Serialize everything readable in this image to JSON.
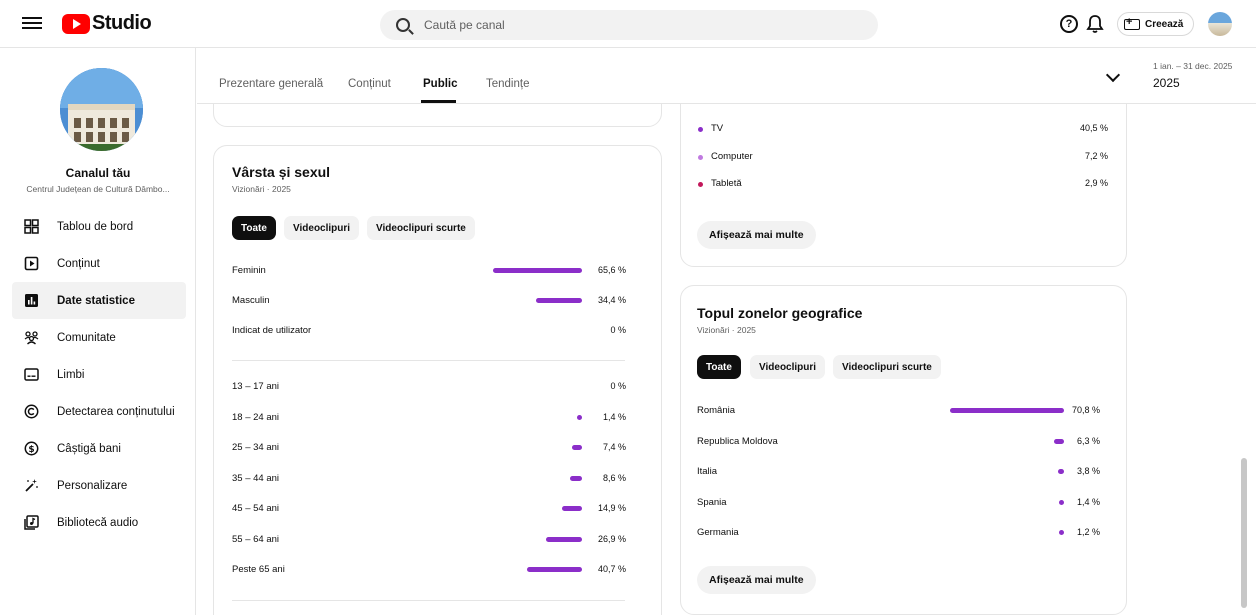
{
  "header": {
    "logo_text": "Studio",
    "search_placeholder": "Caută pe canal",
    "help_label": "?",
    "create_label": "Creează"
  },
  "sidebar": {
    "channel_name": "Canalul tău",
    "channel_subtitle": "Centrul Județean de Cultură Dâmbo...",
    "items": [
      {
        "label": "Tablou de bord",
        "icon": "dashboard-icon"
      },
      {
        "label": "Conținut",
        "icon": "content-icon"
      },
      {
        "label": "Date statistice",
        "icon": "analytics-icon"
      },
      {
        "label": "Comunitate",
        "icon": "community-icon"
      },
      {
        "label": "Limbi",
        "icon": "subtitles-icon"
      },
      {
        "label": "Detectarea conținutului",
        "icon": "copyright-icon"
      },
      {
        "label": "Câștigă bani",
        "icon": "monetization-icon"
      },
      {
        "label": "Personalizare",
        "icon": "magic-wand-icon"
      },
      {
        "label": "Bibliotecă audio",
        "icon": "audio-library-icon"
      }
    ]
  },
  "tabs": {
    "items": [
      "Prezentare generală",
      "Conținut",
      "Public",
      "Tendințe"
    ],
    "active": "Public",
    "date_range": "1 ian. – 31 dec. 2025",
    "year": "2025"
  },
  "age_gender": {
    "title": "Vârsta și sexul",
    "subtitle": "Vizionări · 2025",
    "chips": [
      "Toate",
      "Videoclipuri",
      "Videoclipuri scurte"
    ],
    "gender": [
      {
        "label": "Feminin",
        "value": "65,6 %",
        "pct": 65.6
      },
      {
        "label": "Masculin",
        "value": "34,4 %",
        "pct": 34.4
      },
      {
        "label": "Indicat de utilizator",
        "value": "0 %",
        "pct": 0
      }
    ],
    "ages": [
      {
        "label": "13 – 17 ani",
        "value": "0 %",
        "pct": 0
      },
      {
        "label": "18 – 24 ani",
        "value": "1,4 %",
        "pct": 1.4
      },
      {
        "label": "25 – 34 ani",
        "value": "7,4 %",
        "pct": 7.4
      },
      {
        "label": "35 – 44 ani",
        "value": "8,6 %",
        "pct": 8.6
      },
      {
        "label": "45 – 54 ani",
        "value": "14,9 %",
        "pct": 14.9
      },
      {
        "label": "55 – 64 ani",
        "value": "26,9 %",
        "pct": 26.9
      },
      {
        "label": "Peste 65 ani",
        "value": "40,7 %",
        "pct": 40.7
      }
    ]
  },
  "devices": {
    "items": [
      {
        "label": "TV",
        "value": "40,5 %",
        "color": "#8b2ec9"
      },
      {
        "label": "Computer",
        "value": "7,2 %",
        "color": "#c07ae0"
      },
      {
        "label": "Tabletă",
        "value": "2,9 %",
        "color": "#c2185b"
      }
    ],
    "more_label": "Afișează mai multe"
  },
  "geo": {
    "title": "Topul zonelor geografice",
    "subtitle": "Vizionări · 2025",
    "chips": [
      "Toate",
      "Videoclipuri",
      "Videoclipuri scurte"
    ],
    "items": [
      {
        "label": "România",
        "value": "70,8 %",
        "pct": 70.8
      },
      {
        "label": "Republica Moldova",
        "value": "6,3 %",
        "pct": 6.3
      },
      {
        "label": "Italia",
        "value": "3,8 %",
        "pct": 3.8
      },
      {
        "label": "Spania",
        "value": "1,4 %",
        "pct": 1.4
      },
      {
        "label": "Germania",
        "value": "1,2 %",
        "pct": 1.2
      }
    ],
    "more_label": "Afișează mai multe"
  },
  "colors": {
    "bar": "#8b2ec9",
    "accent_dark": "#0f0f0f",
    "brand_red": "#ff0000"
  }
}
